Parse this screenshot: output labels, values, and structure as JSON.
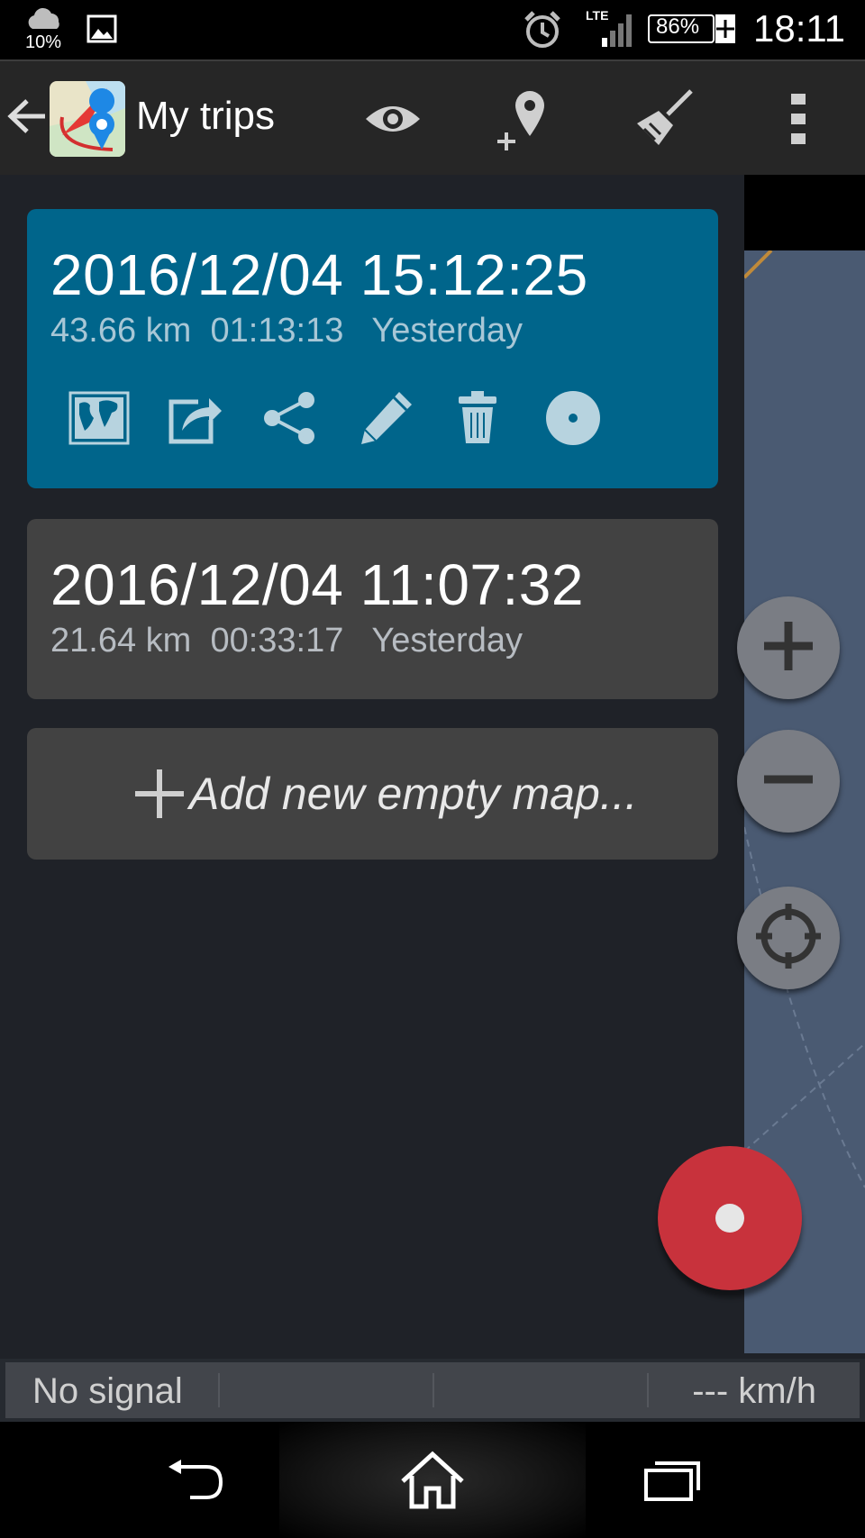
{
  "status_bar": {
    "weather_icon": "cloud-icon",
    "weather_percent": "10%",
    "notification_icon": "image-icon",
    "alarm_icon": "alarm-clock-icon",
    "network": "LTE",
    "battery_percent": "86%",
    "time": "18:11"
  },
  "action_bar": {
    "back_icon": "arrow-back-icon",
    "app_icon": "app-logo",
    "title": "My trips",
    "actions": [
      {
        "name": "view",
        "icon": "eye-icon"
      },
      {
        "name": "add-waypoint",
        "icon": "add-location-icon"
      },
      {
        "name": "clean",
        "icon": "broom-icon"
      },
      {
        "name": "overflow",
        "icon": "more-vertical-icon"
      }
    ]
  },
  "trips": [
    {
      "date": "2016/12/04 15:12:25",
      "distance": "43.66 km",
      "duration": "01:13:13",
      "when": "Yesterday",
      "selected": true,
      "actions": [
        "map-icon",
        "export-icon",
        "share-icon",
        "edit-icon",
        "trash-icon",
        "target-icon"
      ]
    },
    {
      "date": "2016/12/04 11:07:32",
      "distance": "21.64 km",
      "duration": "00:33:17",
      "when": "Yesterday",
      "selected": false
    }
  ],
  "add_map": {
    "icon": "plus-icon",
    "label": "Add new empty map..."
  },
  "map_controls": [
    {
      "name": "zoom-in",
      "icon": "plus-icon"
    },
    {
      "name": "zoom-out",
      "icon": "minus-icon"
    },
    {
      "name": "locate",
      "icon": "crosshair-icon"
    }
  ],
  "record_button": {
    "icon": "record-icon"
  },
  "info_bar": {
    "signal": "No signal",
    "speed": "--- km/h"
  },
  "nav_bar": {
    "back_icon": "nav-back-icon",
    "home_icon": "home-icon",
    "recents_icon": "recents-icon"
  }
}
